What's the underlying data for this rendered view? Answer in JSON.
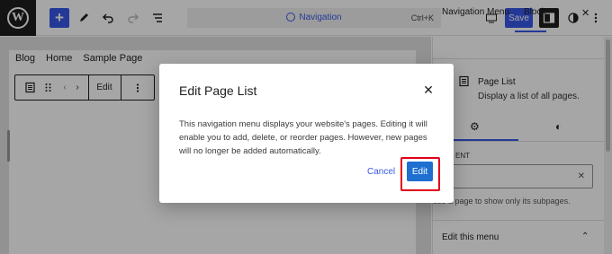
{
  "toolbar": {
    "command_title": "Navigation",
    "command_shortcut": "Ctrl+K",
    "save_label": "Save",
    "wp_logo_letter": "W"
  },
  "canvas": {
    "nav_links": [
      "Blog",
      "Home",
      "Sample Page"
    ],
    "block_toolbar": {
      "edit_label": "Edit"
    }
  },
  "sidebar": {
    "tabs": [
      "Navigation Menu",
      "Block"
    ],
    "active_tab": "Block",
    "block_title": "Page List",
    "block_description": "Display a list of all pages.",
    "parent_label": "ENT",
    "help_text": "ose a page to show only its subpages.",
    "section_title": "Edit this menu"
  },
  "modal": {
    "title": "Edit Page List",
    "body": "This navigation menu displays your website's pages. Editing it will enable you to add, delete, or reorder pages. However, new pages will no longer be added automatically.",
    "cancel_label": "Cancel",
    "edit_label": "Edit"
  },
  "colors": {
    "accent": "#3858e9",
    "dark": "#1e1e1e",
    "highlight": "#e2001a"
  }
}
